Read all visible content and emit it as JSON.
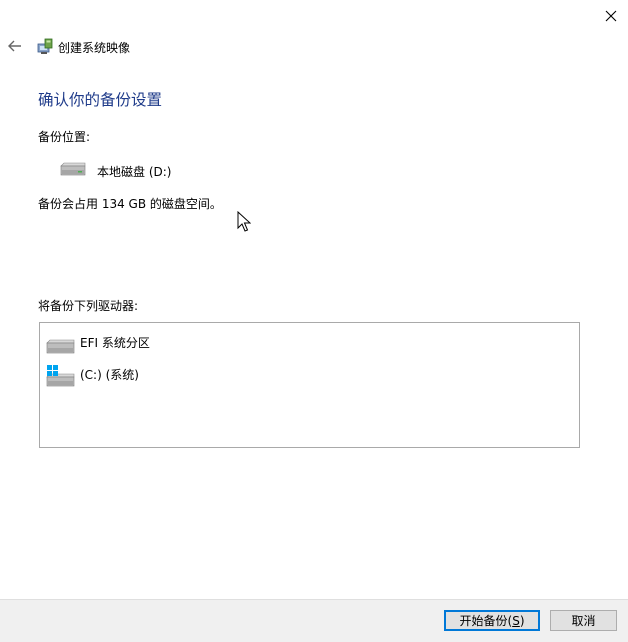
{
  "window": {
    "title": "创建系统映像",
    "close_icon": "close-icon",
    "back_icon": "back-arrow-icon"
  },
  "page": {
    "heading": "确认你的备份设置",
    "backup_location_label": "备份位置:",
    "backup_location": "本地磁盘 (D:)",
    "space_text": "备份会占用 134 GB 的磁盘空间。",
    "drives_label": "将备份下列驱动器:",
    "drives": [
      {
        "label": "EFI 系统分区",
        "icon": "drive-icon"
      },
      {
        "label": "(C:) (系统)",
        "icon": "windows-drive-icon"
      }
    ]
  },
  "footer": {
    "start_prefix": "开始备份(",
    "start_key": "S",
    "start_suffix": ")",
    "cancel_label": "取消"
  },
  "colors": {
    "heading": "#1f3b8a",
    "button_focus_border": "#0078d7",
    "footer_bg": "#f0f0f0"
  }
}
